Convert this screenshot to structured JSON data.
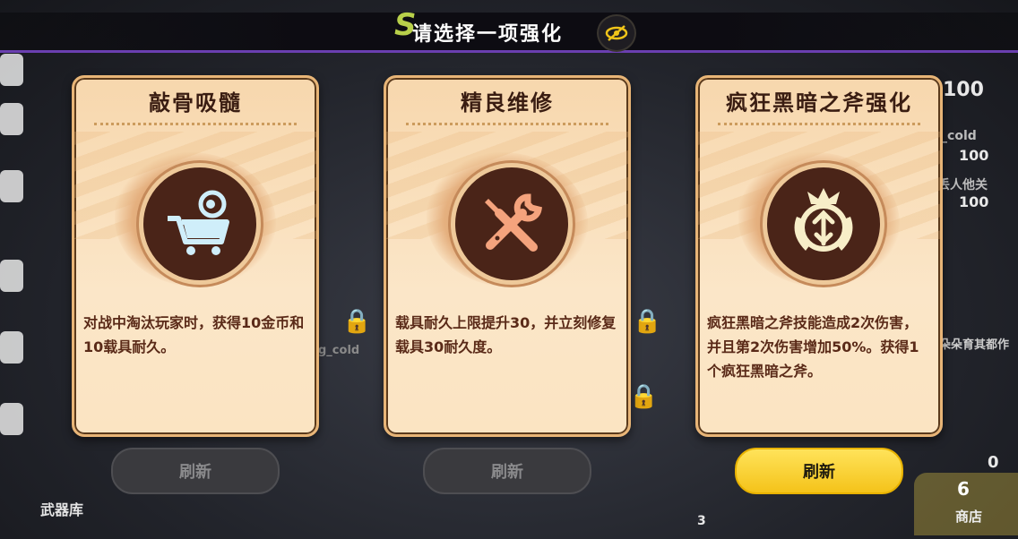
{
  "header": {
    "title": "请选择一项强化",
    "logo_mark": "S",
    "eye_button_icon": "eye-off-icon"
  },
  "cards": [
    {
      "title": "敲骨吸髓",
      "icon": "shopping-cart-coin-icon",
      "description": "对战中淘汰玩家时，获得10金币和10载具耐久。",
      "refresh_label": "刷新",
      "refresh_enabled": false
    },
    {
      "title": "精良维修",
      "icon": "wrench-screwdriver-icon",
      "description": "载具耐久上限提升30，并立刻修复载具30耐久度。",
      "refresh_label": "刷新",
      "refresh_enabled": false
    },
    {
      "title": "疯狂黑暗之斧强化",
      "icon": "dark-axe-emblem-icon",
      "description": "疯狂黑暗之斧技能造成2次伤害，并且第2次伤害增加50%。获得1个疯狂黑暗之斧。",
      "refresh_label": "刷新",
      "refresh_enabled": true
    }
  ],
  "background": {
    "score_top": "100",
    "player_1_name": "g_cold",
    "player_1_score": "100",
    "player_2_name": "丢人他关",
    "player_2_score": "100",
    "right_label": "朵朵育其都作",
    "left_hint": "g_cold",
    "weapon_library": "武器库",
    "shop_label": "商店",
    "shop_count": "6",
    "counter_zero": "0",
    "counter_three": "3"
  },
  "colors": {
    "accent_purple": "#6a3fb0",
    "card_bg": "#fbe4c2",
    "title_text": "#3a1d12",
    "refresh_active": "#f4c31a"
  }
}
